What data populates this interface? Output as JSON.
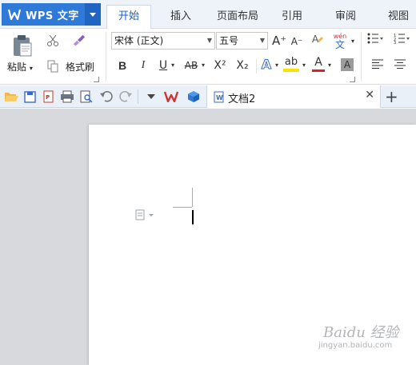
{
  "app": {
    "title": "WPS 文字",
    "accent": "#2f7ad9"
  },
  "tabs": [
    {
      "label": "开始",
      "active": true
    },
    {
      "label": "插入"
    },
    {
      "label": "页面布局"
    },
    {
      "label": "引用"
    },
    {
      "label": "审阅"
    },
    {
      "label": "视图"
    }
  ],
  "ribbon": {
    "paste_label": "粘贴",
    "format_painter_label": "格式刷",
    "font_name": "宋体 (正文)",
    "font_size": "五号",
    "bold": "B",
    "italic": "I",
    "underline": "U",
    "strikethrough": "AB",
    "superscript": "X²",
    "subscript": "X₂",
    "grow_font": "A⁺",
    "shrink_font": "A⁻",
    "pinyin": "文",
    "pinyin_top": "wén",
    "text_effect": "A",
    "highlight": "ab",
    "font_color": "A",
    "char_shading": "A"
  },
  "quick_access": {
    "icons": [
      "open-icon",
      "save-icon",
      "export-pdf-icon",
      "print-icon",
      "print-preview-icon",
      "undo-icon",
      "redo-icon",
      "customize-dropdown-icon"
    ]
  },
  "doc_tab": {
    "label": "文档2"
  },
  "watermark": {
    "brand": "Baidu 经验",
    "url": "jingyan.baidu.com"
  }
}
